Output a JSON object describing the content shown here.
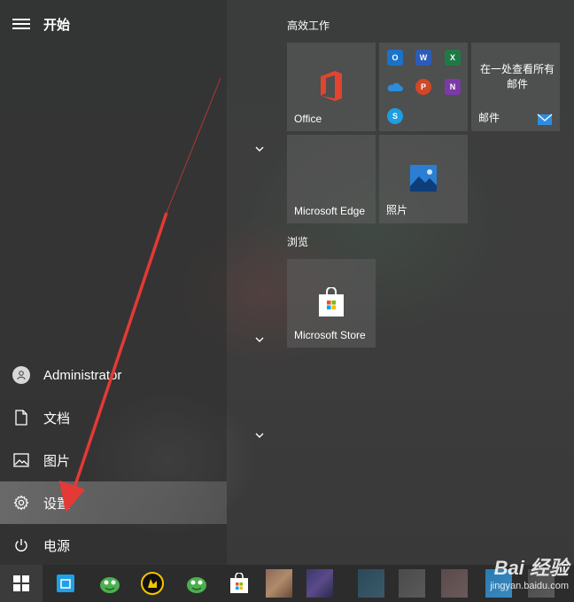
{
  "header": {
    "title": "开始"
  },
  "left_nav": {
    "user": "Administrator",
    "documents": "文档",
    "pictures": "图片",
    "settings": "设置",
    "power": "电源"
  },
  "groups": {
    "productivity": "高效工作",
    "browse": "浏览"
  },
  "tiles": {
    "office": "Office",
    "mail_title": "在一处查看所有邮件",
    "mail_label": "邮件",
    "edge": "Microsoft Edge",
    "photos": "照片",
    "store": "Microsoft Store"
  },
  "mini_icons": [
    "outlook-icon",
    "word-icon",
    "excel-icon",
    "onedrive-icon",
    "powerpoint-icon",
    "onenote-icon",
    "skype-icon"
  ],
  "watermark": {
    "brand": "Bai 经验",
    "url": "jingyan.baidu.com"
  },
  "colors": {
    "arrow": "#e53935",
    "office_red": "#e2442f",
    "mail_blue": "#2e8ce0",
    "photos_blue": "#2a7fd4",
    "start_icon": "#ffffff"
  }
}
